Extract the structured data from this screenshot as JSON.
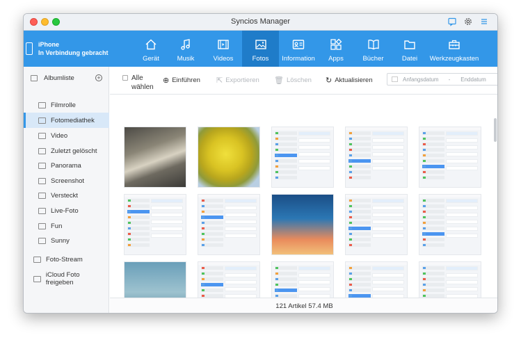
{
  "window": {
    "title": "Syncios Manager"
  },
  "device": {
    "name": "iPhone",
    "status": "In Verbindung gebracht"
  },
  "nav": [
    {
      "label": "Gerät",
      "icon": "home-icon"
    },
    {
      "label": "Musik",
      "icon": "music-icon"
    },
    {
      "label": "Videos",
      "icon": "video-icon"
    },
    {
      "label": "Fotos",
      "icon": "photo-icon",
      "active": true
    },
    {
      "label": "Information",
      "icon": "contact-card-icon"
    },
    {
      "label": "Apps",
      "icon": "apps-icon"
    },
    {
      "label": "Bücher",
      "icon": "book-icon"
    },
    {
      "label": "Datei",
      "icon": "folder-icon"
    },
    {
      "label": "Werkzeugkasten",
      "icon": "toolbox-icon"
    }
  ],
  "sidebar": {
    "header": "Albumliste",
    "items": [
      "Filmrolle",
      "Fotomediathek",
      "Video",
      "Zuletzt gelöscht",
      "Panorama",
      "Screenshot",
      "Versteckt",
      "Live-Foto",
      "Fun",
      "Sunny"
    ],
    "active": "Fotomediathek",
    "bottom": [
      "Foto-Stream",
      "iCloud Foto freigeben"
    ]
  },
  "toolbar": {
    "select_all": "Alle wählen",
    "import": "Einführen",
    "export": "Exportieren",
    "delete": "Löschen",
    "refresh": "Aktualisieren",
    "start_date": "Anfangsdatum",
    "separator": "-",
    "end_date": "Enddatum"
  },
  "footer": {
    "summary": "121 Artikel 57.4 MB"
  },
  "colors": {
    "accent": "#3397e8",
    "active_tab": "#1f7cc9",
    "selection": "#d8e8f8"
  }
}
